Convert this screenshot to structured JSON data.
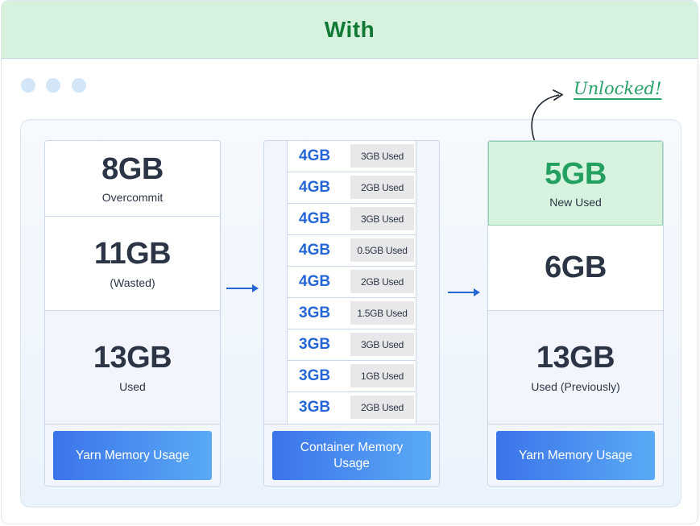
{
  "header": {
    "title": "With"
  },
  "annotation": {
    "label": "Unlocked!"
  },
  "left_column": {
    "blocks": [
      {
        "value": "8GB",
        "caption": "Overcommit"
      },
      {
        "value": "11GB",
        "caption": "(Wasted)"
      },
      {
        "value": "13GB",
        "caption": "Used"
      }
    ],
    "footer_label": "Yarn Memory Usage"
  },
  "container_column": {
    "rows": [
      {
        "size": "4GB",
        "used": "3GB Used"
      },
      {
        "size": "4GB",
        "used": "2GB Used"
      },
      {
        "size": "4GB",
        "used": "3GB Used"
      },
      {
        "size": "4GB",
        "used": "0.5GB Used"
      },
      {
        "size": "4GB",
        "used": "2GB Used"
      },
      {
        "size": "3GB",
        "used": "1.5GB Used"
      },
      {
        "size": "3GB",
        "used": "3GB Used"
      },
      {
        "size": "3GB",
        "used": "1GB Used"
      },
      {
        "size": "3GB",
        "used": "2GB Used"
      }
    ],
    "footer_label": "Container Memory Usage"
  },
  "right_column": {
    "blocks": [
      {
        "value": "5GB",
        "caption": "New Used"
      },
      {
        "value": "6GB",
        "caption": ""
      },
      {
        "value": "13GB",
        "caption": "Used (Previously)"
      }
    ],
    "footer_label": "Yarn Memory Usage"
  },
  "colors": {
    "header_bg": "#d6f2de",
    "header_text": "#107a35",
    "accent_green": "#23a05f",
    "accent_blue": "#2566d6",
    "button_gradient_start": "#3b74ea",
    "button_gradient_end": "#5aaaf6"
  },
  "icons": [
    "window-dot-icon",
    "arrow-right-icon",
    "curved-arrow-icon"
  ]
}
